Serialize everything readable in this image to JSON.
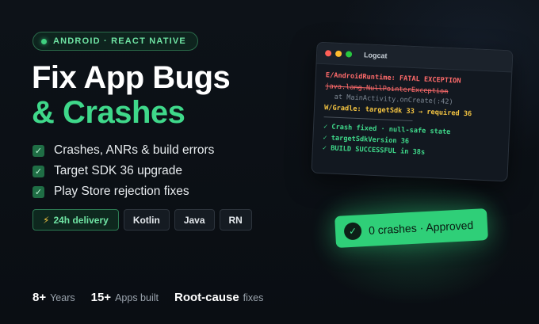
{
  "badge": {
    "text": "ANDROID · REACT NATIVE"
  },
  "headline": {
    "line1": "Fix App Bugs",
    "line2": "& Crashes"
  },
  "checklist": [
    {
      "icon": "✓",
      "label": "Crashes, ANRs & build errors"
    },
    {
      "icon": "✓",
      "label": "Target SDK 36 upgrade"
    },
    {
      "icon": "✓",
      "label": "Play Store rejection fixes"
    }
  ],
  "tags": [
    {
      "icon": "⚡",
      "label": "24h delivery"
    },
    {
      "label": "Kotlin"
    },
    {
      "label": "Java"
    },
    {
      "label": "RN"
    }
  ],
  "stats": [
    {
      "value": "8+",
      "label": "Years"
    },
    {
      "value": "15+",
      "label": "Apps built"
    },
    {
      "value": "Root-cause",
      "label": "fixes"
    }
  ],
  "terminal": {
    "title": "Logcat",
    "lines": [
      "E/AndroidRuntime: FATAL EXCEPTION",
      "java.lang.NullPointerException",
      "at MainActivity.onCreate(:42)",
      "W/Gradle: targetSdk 33 → required 36",
      "✓ Crash fixed · null-safe state",
      "✓ targetSdkVersion 36",
      "✓ BUILD SUCCESSFUL in 38s"
    ]
  },
  "approved": {
    "icon": "✓",
    "text": "0 crashes · Approved"
  },
  "colors": {
    "background": "#0b0f14",
    "accent": "#3fd88a",
    "error": "#ff6b6b",
    "warning": "#f5c542"
  }
}
